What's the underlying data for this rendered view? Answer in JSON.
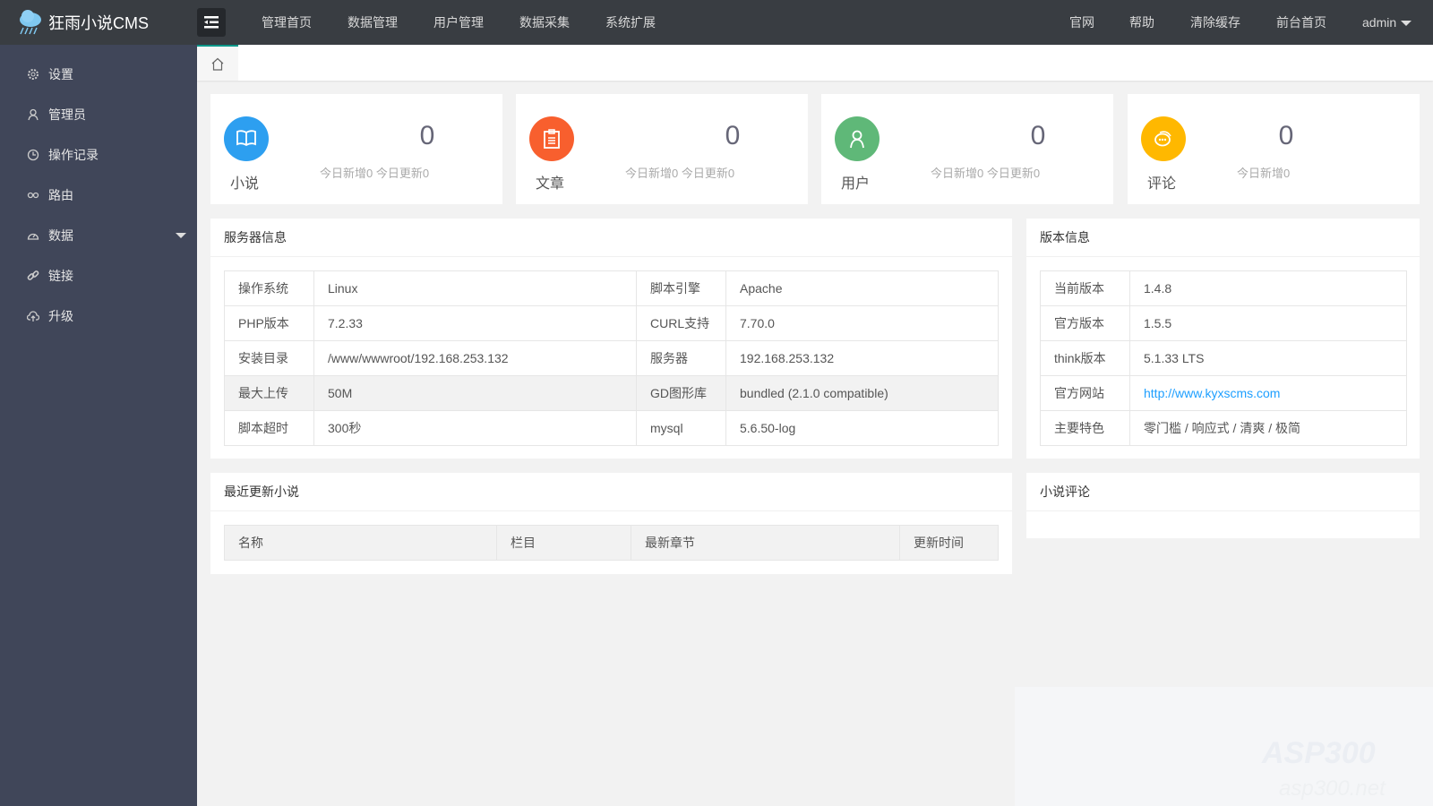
{
  "header": {
    "app_title": "狂雨小说CMS",
    "nav": [
      "管理首页",
      "数据管理",
      "用户管理",
      "数据采集",
      "系统扩展"
    ],
    "right": [
      "官网",
      "帮助",
      "清除缓存",
      "前台首页"
    ],
    "user": "admin"
  },
  "sidebar": {
    "items": [
      {
        "label": "设置",
        "icon": "gear-icon"
      },
      {
        "label": "管理员",
        "icon": "user-icon"
      },
      {
        "label": "操作记录",
        "icon": "clock-icon"
      },
      {
        "label": "路由",
        "icon": "route-icon"
      },
      {
        "label": "数据",
        "icon": "dashboard-icon"
      },
      {
        "label": "链接",
        "icon": "link-icon"
      },
      {
        "label": "升级",
        "icon": "cloud-upload-icon"
      }
    ]
  },
  "cards": [
    {
      "label": "小说",
      "count": "0",
      "sub": "今日新增0 今日更新0",
      "color": "#2d9ff0",
      "icon": "book-icon"
    },
    {
      "label": "文章",
      "count": "0",
      "sub": "今日新增0 今日更新0",
      "color": "#f85f2e",
      "icon": "clipboard-icon"
    },
    {
      "label": "用户",
      "count": "0",
      "sub": "今日新增0 今日更新0",
      "color": "#5fb878",
      "icon": "user-icon"
    },
    {
      "label": "评论",
      "count": "0",
      "sub": "今日新增0",
      "color": "#ffb800",
      "icon": "comment-icon"
    }
  ],
  "server": {
    "title": "服务器信息",
    "rows": [
      [
        "操作系统",
        "Linux",
        "脚本引擎",
        "Apache"
      ],
      [
        "PHP版本",
        "7.2.33",
        "CURL支持",
        "7.70.0"
      ],
      [
        "安装目录",
        "/www/wwwroot/192.168.253.132",
        "服务器",
        "192.168.253.132"
      ],
      [
        "最大上传",
        "50M",
        "GD图形库",
        "bundled (2.1.0 compatible)"
      ],
      [
        "脚本超时",
        "300秒",
        "mysql",
        "5.6.50-log"
      ]
    ]
  },
  "version": {
    "title": "版本信息",
    "rows": [
      [
        "当前版本",
        "1.4.8"
      ],
      [
        "官方版本",
        "1.5.5"
      ],
      [
        "think版本",
        "5.1.33 LTS"
      ],
      [
        "官方网站",
        "http://www.kyxscms.com"
      ],
      [
        "主要特色",
        "零门槛 / 响应式 / 清爽 / 极简"
      ]
    ]
  },
  "recent": {
    "title": "最近更新小说",
    "headers": [
      "名称",
      "栏目",
      "最新章节",
      "更新时间"
    ]
  },
  "comments": {
    "title": "小说评论"
  },
  "watermark": {
    "line1": "ASP300",
    "line2": "asp300.net"
  }
}
